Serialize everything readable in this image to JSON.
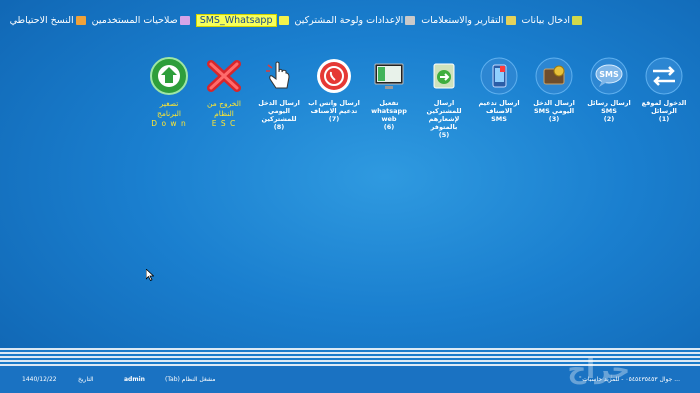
{
  "menu": [
    {
      "label": "ادخال بيانات",
      "icon": "bar-chart-icon",
      "color": "#d1d94a",
      "highlight": false
    },
    {
      "label": "التقارير والاستعلامات",
      "icon": "report-icon",
      "color": "#e4d25a",
      "highlight": false
    },
    {
      "label": "الإعدادات ولوحة المشتركين",
      "icon": "settings-icon",
      "color": "#c9c9c9",
      "highlight": false
    },
    {
      "label": "SMS_Whatsapp",
      "icon": "whatsapp-icon",
      "color": "#f2f24a",
      "highlight": true
    },
    {
      "label": "صلاحيات المستخدمين",
      "icon": "users-icon",
      "color": "#d6a4e8",
      "highlight": false
    },
    {
      "label": "النسخ الاحتياطي",
      "icon": "home-icon",
      "color": "#f0a23a",
      "highlight": false
    }
  ],
  "tools": [
    {
      "label": "الدخول لموقع\nالرسائل\n(1)",
      "name": "goto-sms-site-button",
      "icon": "arrows-icon"
    },
    {
      "label": "ارسال رسائل\nSMS\n(2)",
      "name": "send-sms-button",
      "icon": "sms-bubble-icon"
    },
    {
      "label": "ارسال الدخل\nSMS اليومي\n(3)",
      "name": "send-daily-income-sms-button",
      "icon": "wallet-icon"
    },
    {
      "label": "ارسال تدعيم\nالاصناف\nSMS",
      "name": "send-stock-sms-button",
      "icon": "phone-icon"
    },
    {
      "label": "ارسال للمشتركين\nلإشعارهم بالمتوفر\n(5)",
      "name": "notify-subscribers-button",
      "icon": "document-arrow-icon"
    },
    {
      "label": "تفعيل\nwhatsapp web\n(6)",
      "name": "activate-whatsapp-web-button",
      "icon": "monitor-icon"
    },
    {
      "label": "ارسال واتس اب\nتدعيم الاصناف\n(7)",
      "name": "send-whatsapp-stock-button",
      "icon": "whatsapp-icon"
    },
    {
      "label": "ارسال الدخل\nاليومي للمشتركين\n(8)",
      "name": "send-daily-income-subscribers-button",
      "icon": "hand-pointer-icon"
    },
    {
      "label": "الخروج من\nالنظام\nE S C",
      "name": "exit-system-button",
      "icon": "close-x-icon",
      "yellow": true
    },
    {
      "label": "تصغير\nالبرنامج\nD o w n",
      "name": "minimize-program-button",
      "icon": "arrow-down-circle-icon",
      "yellow": true
    }
  ],
  "status": {
    "date": "1440/12/22",
    "date_label": "التاريخ",
    "user": "admin",
    "shortcut": "(Tab) مشغل النظام",
    "right_text": "جوال ٠٥٤٥٤٣٥٤٥٣ - للمزيد حاسبات ...",
    "watermark": "حراج"
  },
  "colors": {
    "background": "#1a7fcf",
    "yellow": "#ffe631"
  }
}
